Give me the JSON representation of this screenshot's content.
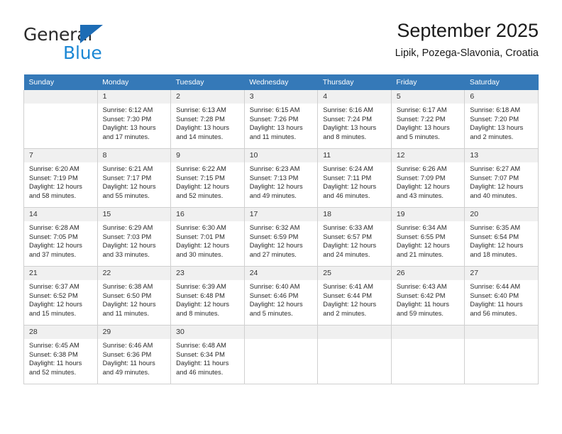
{
  "brand": {
    "name_part1": "General",
    "name_part2": "Blue",
    "accent_color": "#1b87d4",
    "triangle_color": "#1d6cb5"
  },
  "header": {
    "title": "September 2025",
    "subtitle": "Lipik, Pozega-Slavonia, Croatia"
  },
  "calendar": {
    "header_bg": "#3579b8",
    "daynum_bg": "#f0f0f0",
    "weekday_labels": [
      "Sunday",
      "Monday",
      "Tuesday",
      "Wednesday",
      "Thursday",
      "Friday",
      "Saturday"
    ],
    "labels": {
      "sunrise": "Sunrise:",
      "sunset": "Sunset:",
      "daylight": "Daylight:"
    },
    "weeks": [
      [
        {
          "day": "",
          "empty": true
        },
        {
          "day": "1",
          "sunrise": "Sunrise: 6:12 AM",
          "sunset": "Sunset: 7:30 PM",
          "daylight_1": "Daylight: 13 hours",
          "daylight_2": "and 17 minutes."
        },
        {
          "day": "2",
          "sunrise": "Sunrise: 6:13 AM",
          "sunset": "Sunset: 7:28 PM",
          "daylight_1": "Daylight: 13 hours",
          "daylight_2": "and 14 minutes."
        },
        {
          "day": "3",
          "sunrise": "Sunrise: 6:15 AM",
          "sunset": "Sunset: 7:26 PM",
          "daylight_1": "Daylight: 13 hours",
          "daylight_2": "and 11 minutes."
        },
        {
          "day": "4",
          "sunrise": "Sunrise: 6:16 AM",
          "sunset": "Sunset: 7:24 PM",
          "daylight_1": "Daylight: 13 hours",
          "daylight_2": "and 8 minutes."
        },
        {
          "day": "5",
          "sunrise": "Sunrise: 6:17 AM",
          "sunset": "Sunset: 7:22 PM",
          "daylight_1": "Daylight: 13 hours",
          "daylight_2": "and 5 minutes."
        },
        {
          "day": "6",
          "sunrise": "Sunrise: 6:18 AM",
          "sunset": "Sunset: 7:20 PM",
          "daylight_1": "Daylight: 13 hours",
          "daylight_2": "and 2 minutes."
        }
      ],
      [
        {
          "day": "7",
          "sunrise": "Sunrise: 6:20 AM",
          "sunset": "Sunset: 7:19 PM",
          "daylight_1": "Daylight: 12 hours",
          "daylight_2": "and 58 minutes."
        },
        {
          "day": "8",
          "sunrise": "Sunrise: 6:21 AM",
          "sunset": "Sunset: 7:17 PM",
          "daylight_1": "Daylight: 12 hours",
          "daylight_2": "and 55 minutes."
        },
        {
          "day": "9",
          "sunrise": "Sunrise: 6:22 AM",
          "sunset": "Sunset: 7:15 PM",
          "daylight_1": "Daylight: 12 hours",
          "daylight_2": "and 52 minutes."
        },
        {
          "day": "10",
          "sunrise": "Sunrise: 6:23 AM",
          "sunset": "Sunset: 7:13 PM",
          "daylight_1": "Daylight: 12 hours",
          "daylight_2": "and 49 minutes."
        },
        {
          "day": "11",
          "sunrise": "Sunrise: 6:24 AM",
          "sunset": "Sunset: 7:11 PM",
          "daylight_1": "Daylight: 12 hours",
          "daylight_2": "and 46 minutes."
        },
        {
          "day": "12",
          "sunrise": "Sunrise: 6:26 AM",
          "sunset": "Sunset: 7:09 PM",
          "daylight_1": "Daylight: 12 hours",
          "daylight_2": "and 43 minutes."
        },
        {
          "day": "13",
          "sunrise": "Sunrise: 6:27 AM",
          "sunset": "Sunset: 7:07 PM",
          "daylight_1": "Daylight: 12 hours",
          "daylight_2": "and 40 minutes."
        }
      ],
      [
        {
          "day": "14",
          "sunrise": "Sunrise: 6:28 AM",
          "sunset": "Sunset: 7:05 PM",
          "daylight_1": "Daylight: 12 hours",
          "daylight_2": "and 37 minutes."
        },
        {
          "day": "15",
          "sunrise": "Sunrise: 6:29 AM",
          "sunset": "Sunset: 7:03 PM",
          "daylight_1": "Daylight: 12 hours",
          "daylight_2": "and 33 minutes."
        },
        {
          "day": "16",
          "sunrise": "Sunrise: 6:30 AM",
          "sunset": "Sunset: 7:01 PM",
          "daylight_1": "Daylight: 12 hours",
          "daylight_2": "and 30 minutes."
        },
        {
          "day": "17",
          "sunrise": "Sunrise: 6:32 AM",
          "sunset": "Sunset: 6:59 PM",
          "daylight_1": "Daylight: 12 hours",
          "daylight_2": "and 27 minutes."
        },
        {
          "day": "18",
          "sunrise": "Sunrise: 6:33 AM",
          "sunset": "Sunset: 6:57 PM",
          "daylight_1": "Daylight: 12 hours",
          "daylight_2": "and 24 minutes."
        },
        {
          "day": "19",
          "sunrise": "Sunrise: 6:34 AM",
          "sunset": "Sunset: 6:55 PM",
          "daylight_1": "Daylight: 12 hours",
          "daylight_2": "and 21 minutes."
        },
        {
          "day": "20",
          "sunrise": "Sunrise: 6:35 AM",
          "sunset": "Sunset: 6:54 PM",
          "daylight_1": "Daylight: 12 hours",
          "daylight_2": "and 18 minutes."
        }
      ],
      [
        {
          "day": "21",
          "sunrise": "Sunrise: 6:37 AM",
          "sunset": "Sunset: 6:52 PM",
          "daylight_1": "Daylight: 12 hours",
          "daylight_2": "and 15 minutes."
        },
        {
          "day": "22",
          "sunrise": "Sunrise: 6:38 AM",
          "sunset": "Sunset: 6:50 PM",
          "daylight_1": "Daylight: 12 hours",
          "daylight_2": "and 11 minutes."
        },
        {
          "day": "23",
          "sunrise": "Sunrise: 6:39 AM",
          "sunset": "Sunset: 6:48 PM",
          "daylight_1": "Daylight: 12 hours",
          "daylight_2": "and 8 minutes."
        },
        {
          "day": "24",
          "sunrise": "Sunrise: 6:40 AM",
          "sunset": "Sunset: 6:46 PM",
          "daylight_1": "Daylight: 12 hours",
          "daylight_2": "and 5 minutes."
        },
        {
          "day": "25",
          "sunrise": "Sunrise: 6:41 AM",
          "sunset": "Sunset: 6:44 PM",
          "daylight_1": "Daylight: 12 hours",
          "daylight_2": "and 2 minutes."
        },
        {
          "day": "26",
          "sunrise": "Sunrise: 6:43 AM",
          "sunset": "Sunset: 6:42 PM",
          "daylight_1": "Daylight: 11 hours",
          "daylight_2": "and 59 minutes."
        },
        {
          "day": "27",
          "sunrise": "Sunrise: 6:44 AM",
          "sunset": "Sunset: 6:40 PM",
          "daylight_1": "Daylight: 11 hours",
          "daylight_2": "and 56 minutes."
        }
      ],
      [
        {
          "day": "28",
          "sunrise": "Sunrise: 6:45 AM",
          "sunset": "Sunset: 6:38 PM",
          "daylight_1": "Daylight: 11 hours",
          "daylight_2": "and 52 minutes."
        },
        {
          "day": "29",
          "sunrise": "Sunrise: 6:46 AM",
          "sunset": "Sunset: 6:36 PM",
          "daylight_1": "Daylight: 11 hours",
          "daylight_2": "and 49 minutes."
        },
        {
          "day": "30",
          "sunrise": "Sunrise: 6:48 AM",
          "sunset": "Sunset: 6:34 PM",
          "daylight_1": "Daylight: 11 hours",
          "daylight_2": "and 46 minutes."
        },
        {
          "day": "",
          "empty": true
        },
        {
          "day": "",
          "empty": true
        },
        {
          "day": "",
          "empty": true
        },
        {
          "day": "",
          "empty": true
        }
      ]
    ]
  }
}
